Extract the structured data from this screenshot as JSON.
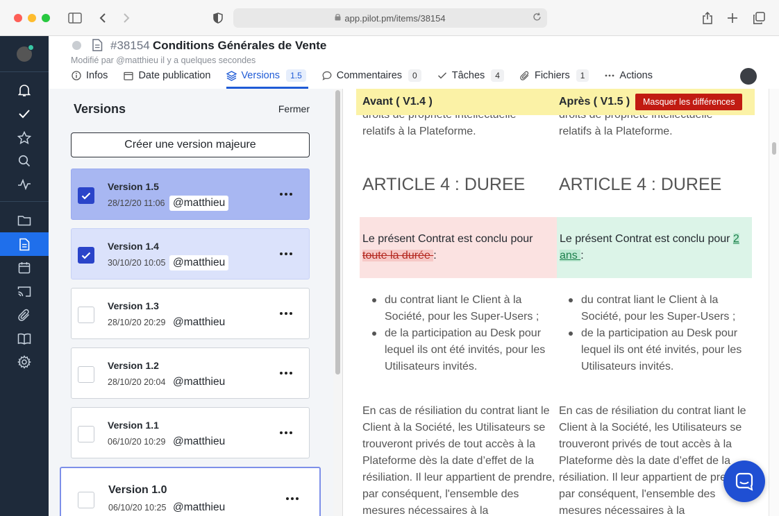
{
  "browser": {
    "url": "app.pilot.pm/items/38154",
    "icons": [
      "sidebar-toggle-icon",
      "back-icon",
      "forward-icon",
      "privacy-shield-icon",
      "lock-icon",
      "reload-icon",
      "share-icon",
      "new-tab-icon",
      "tabs-overview-icon"
    ]
  },
  "sidebar": {
    "icons": [
      "bell-icon",
      "check-icon",
      "star-icon",
      "search-icon",
      "activity-icon",
      "folder-icon",
      "document-icon",
      "calendar-icon",
      "cast-icon",
      "paperclip-icon",
      "book-icon",
      "gear-icon"
    ],
    "active": "document-icon"
  },
  "header": {
    "item_id": "#38154",
    "title": "Conditions Générales de Vente",
    "modified": "Modifié par  @matthieu il y a quelques secondes",
    "tabs": [
      {
        "label": "Infos",
        "count": "",
        "icon": "info-icon"
      },
      {
        "label": "Date publication",
        "count": "",
        "icon": "calendar-icon"
      },
      {
        "label": "Versions",
        "count": "1.5",
        "icon": "layers-icon",
        "active": true
      },
      {
        "label": "Commentaires",
        "count": "0",
        "icon": "comment-icon"
      },
      {
        "label": "Tâches",
        "count": "4",
        "icon": "check-icon"
      },
      {
        "label": "Fichiers",
        "count": "1",
        "icon": "paperclip-icon"
      },
      {
        "label": "Actions",
        "count": "",
        "icon": "more-horizontal-icon"
      }
    ]
  },
  "versions_panel": {
    "title": "Versions",
    "close_label": "Fermer",
    "create_major_label": "Créer une version majeure",
    "versions": [
      {
        "name": "Version 1.5",
        "date": "28/12/20 11:06",
        "user": "@matthieu",
        "checked": true
      },
      {
        "name": "Version 1.4",
        "date": "30/10/20 10:05",
        "user": "@matthieu",
        "checked": true
      },
      {
        "name": "Version 1.3",
        "date": "28/10/20 20:29",
        "user": "@matthieu",
        "checked": false
      },
      {
        "name": "Version 1.2",
        "date": "28/10/20 20:04",
        "user": "@matthieu",
        "checked": false
      },
      {
        "name": "Version 1.1",
        "date": "06/10/20 10:29",
        "user": "@matthieu",
        "checked": false
      },
      {
        "name": "Version 1.0",
        "date": "06/10/20 10:25",
        "user": "@matthieu",
        "checked": false
      }
    ]
  },
  "diff": {
    "before_label": "Avant ( V1.4 )",
    "after_label": "Après ( V1.5 )",
    "hide_diff_label": "Masquer les différences",
    "colors": {
      "header_bg": "#fbf2a6",
      "deleted_bg": "#fbe2e1",
      "added_bg": "#dcf4e8",
      "button": "#c11b12"
    },
    "fragment_line1": "droits de propriété intellectuelle",
    "fragment_line2": "relatifs à la Plateforme.",
    "article_heading": "ARTICLE 4 : DUREE",
    "changed_prefix": "Le présent Contrat est conclu pour ",
    "deleted_text": " toute la durée ",
    "added_text": " 2 ans ",
    "changed_suffix": " :",
    "bullets": [
      "du contrat liant le Client à la Société, pour les Super-Users ;",
      "de la participation au Desk pour lequel ils ont été invités, pour les Utilisateurs invités."
    ],
    "paragraph": "En cas de résiliation du contrat liant le Client à la Société, les Utilisateurs se trouveront privés de tout accès à la Plateforme dès la date d’effet de la résiliation. Il leur appartient de prendre, par conséquent, l'ensemble des  mesures nécessaires à la"
  }
}
